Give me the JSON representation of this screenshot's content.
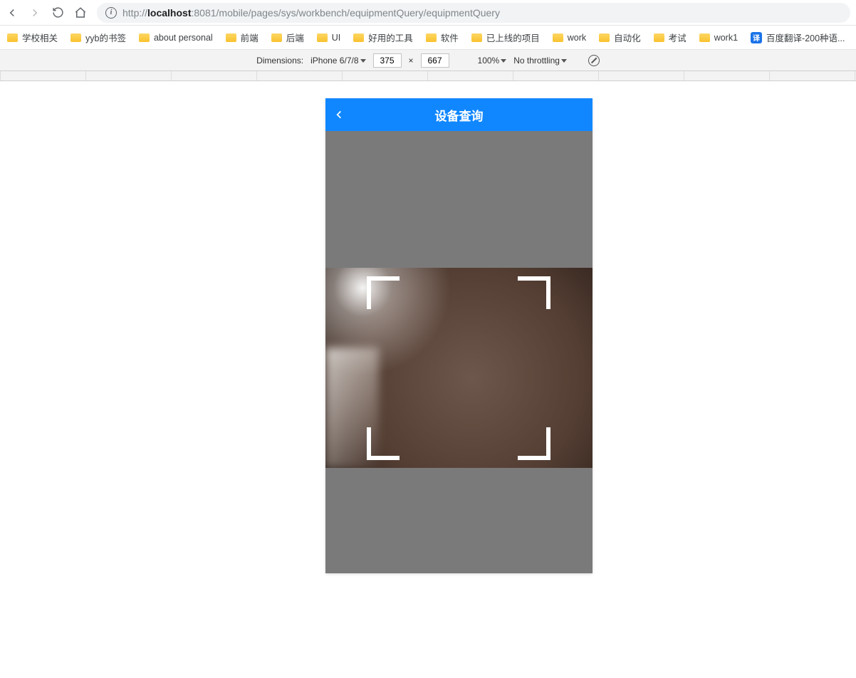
{
  "url": {
    "prefix": "http://",
    "host": "localhost",
    "port_and_path": ":8081/mobile/pages/sys/workbench/equipmentQuery/equipmentQuery"
  },
  "bookmarks": [
    {
      "label": "学校相关",
      "kind": "folder"
    },
    {
      "label": "yyb的书签",
      "kind": "folder"
    },
    {
      "label": "about personal",
      "kind": "folder"
    },
    {
      "label": "前端",
      "kind": "folder"
    },
    {
      "label": "后端",
      "kind": "folder"
    },
    {
      "label": "UI",
      "kind": "folder"
    },
    {
      "label": "好用的工具",
      "kind": "folder"
    },
    {
      "label": "软件",
      "kind": "folder"
    },
    {
      "label": "已上线的项目",
      "kind": "folder"
    },
    {
      "label": "work",
      "kind": "folder"
    },
    {
      "label": "自动化",
      "kind": "folder"
    },
    {
      "label": "考试",
      "kind": "folder"
    },
    {
      "label": "work1",
      "kind": "folder"
    },
    {
      "label": "百度翻译-200种语...",
      "kind": "translate"
    }
  ],
  "devtools": {
    "dimensions_label": "Dimensions:",
    "device_preset": "iPhone 6/7/8",
    "width": "375",
    "separator": "×",
    "height": "667",
    "zoom": "100%",
    "throttling": "No throttling"
  },
  "app": {
    "title": "设备查询"
  },
  "colors": {
    "accent_blue": "#1087ff",
    "device_grey": "#7a7a7a",
    "ruler_bg": "#f3f3f3"
  }
}
